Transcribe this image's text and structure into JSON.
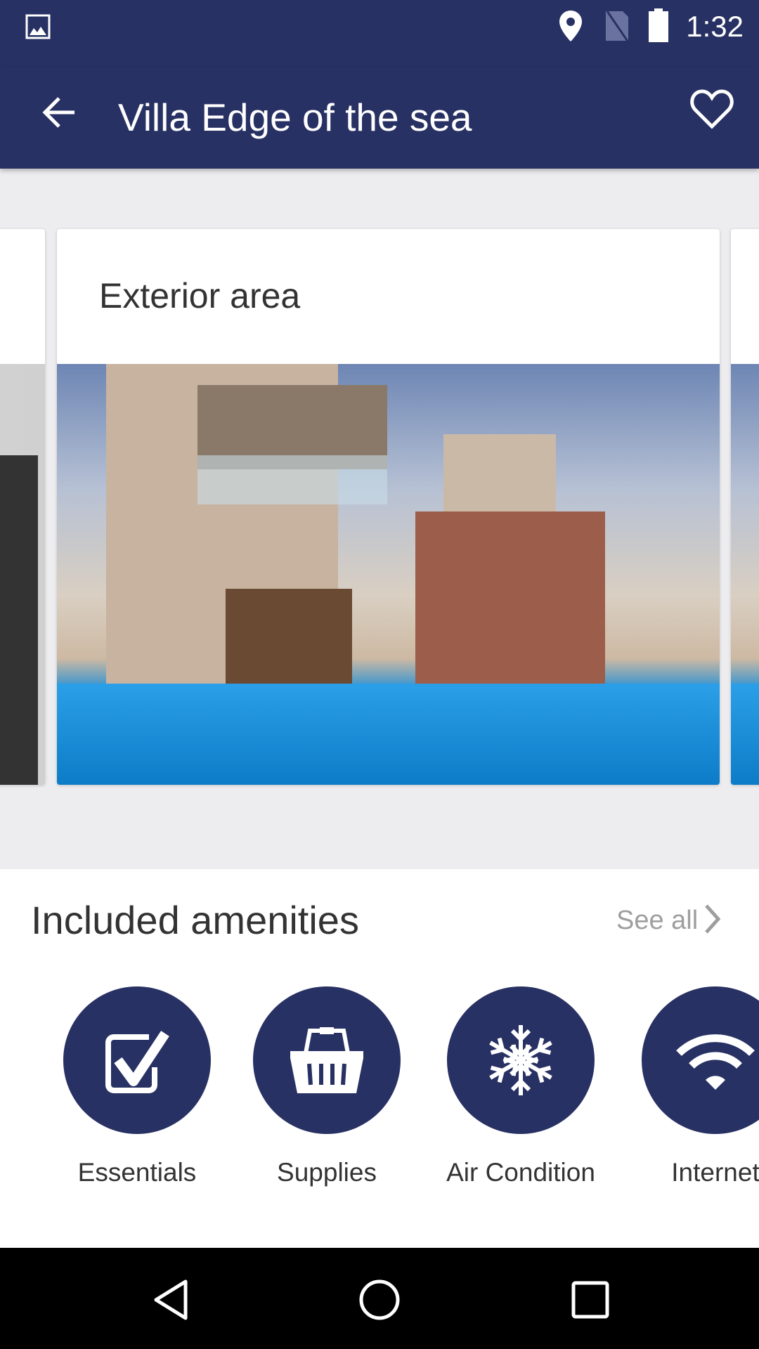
{
  "status_bar": {
    "time": "1:32",
    "icons": [
      "image-icon",
      "location-icon",
      "no-sim-icon",
      "battery-icon"
    ]
  },
  "app_bar": {
    "title": "Villa Edge of the sea",
    "back_icon": "arrow-back-icon",
    "favorite_icon": "heart-outline-icon"
  },
  "gallery": {
    "current_card": {
      "title": "Exterior area"
    }
  },
  "amenities": {
    "title": "Included amenities",
    "see_all": "See all",
    "items": [
      {
        "label": "Essentials",
        "icon": "checkbox-icon"
      },
      {
        "label": "Supplies",
        "icon": "basket-icon"
      },
      {
        "label": "Air Condition",
        "icon": "snowflake-icon"
      },
      {
        "label": "Internet",
        "icon": "wifi-icon"
      }
    ]
  },
  "colors": {
    "primary": "#283163",
    "background": "#ededf0",
    "see_all": "#9e9e9e"
  }
}
